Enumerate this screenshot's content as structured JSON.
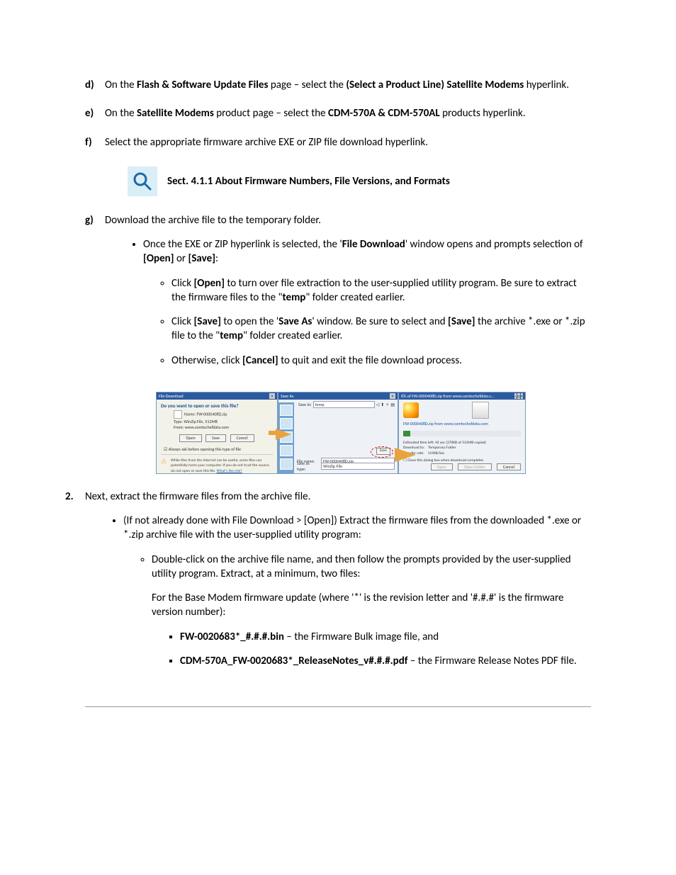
{
  "steps": {
    "d": {
      "label": "d)",
      "pre": "On the ",
      "b1": "Flash & Software Update Files",
      "mid": " page – select the ",
      "b2": "(Select a Product Line) Satellite Modems",
      "post": " hyperlink."
    },
    "e": {
      "label": "e)",
      "pre": "On the ",
      "b1": "Satellite Modems",
      "mid": " product page – select the ",
      "b2": "CDM-570A & CDM-570AL",
      "post": " products hyperlink."
    },
    "f": {
      "label": "f)",
      "text": "Select the appropriate firmware archive EXE or ZIP file download hyperlink."
    },
    "sect": "Sect. 4.1.1 About Firmware Numbers, File Versions, and Formats",
    "g": {
      "label": "g)",
      "text": "Download the archive file to the temporary folder.",
      "b1_pre": "Once the EXE or ZIP hyperlink is selected, the '",
      "b1_b": "File Download",
      "b1_mid": "' window opens and prompts selection of ",
      "b1_b2": "[Open]",
      "b1_or": " or ",
      "b1_b3": "[Save]",
      "b1_post": ":",
      "o1_pre": "Click ",
      "o1_b": "[Open]",
      "o1_mid": " to turn over file extraction to the user-supplied utility program. Be sure to extract the firmware files to the \"",
      "o1_b2": "temp",
      "o1_post": "\" folder created earlier.",
      "o2_pre": "Click ",
      "o2_b": "[Save]",
      "o2_mid": " to open the '",
      "o2_b2": "Save As",
      "o2_mid2": "' window. Be sure to select and ",
      "o2_b3": "[Save]",
      "o2_mid3": " the archive *.exe or *.zip file to the \"",
      "o2_b4": "temp",
      "o2_post": "\" folder created earlier.",
      "o3_pre": "Otherwise, click ",
      "o3_b": "[Cancel]",
      "o3_post": " to quit and exit the file download process."
    },
    "two": {
      "label": "2.",
      "text": "Next, extract the firmware files from the archive file.",
      "b1": "(If not already done with File Download > [Open]) Extract the firmware files from the downloaded *.exe or *.zip archive file with the user-supplied utility program:",
      "o1": "Double-click on the archive file name, and then follow the prompts provided by the user-supplied utility program. Extract, at a minimum, two files:",
      "para": "For the Base Modem firmware update (where '*' is the revision letter and '#.#.#' is the firmware version number):",
      "s1_b": "FW-0020683*_#.#.#.bin",
      "s1_post": " – the Firmware Bulk image file, and",
      "s2_b": "CDM-570A_FW-0020683*_ReleaseNotes_v#.#.#.pdf",
      "s2_post": " – the Firmware Release Notes PDF file."
    }
  },
  "dlg1": {
    "title": "File Download",
    "question": "Do you want to open or save this file?",
    "name": "Name:  FW-0000408D.zip",
    "type": "Type:  WinZip File, 512MB",
    "from": "From:  www.comtechefdata.com",
    "open": "Open",
    "save": "Save",
    "cancel": "Cancel",
    "ask": "Always ask before opening this type of file",
    "warn": "While files from the Internet can be useful, some files can potentially harm your computer. If you do not trust the source, do not open or save this file. ",
    "risk": "What's the risk?"
  },
  "dlg2": {
    "title": "Save As",
    "savein": "Save in:",
    "savein_val": "temp",
    "filename": "File name:",
    "filename_val": "FW-0000408D.zip",
    "saveas": "Save as type:",
    "saveas_val": "WinZip File",
    "save": "Save"
  },
  "dlg3": {
    "title": "6% of FW-0000408D.zip from www.comtechefdata.c…",
    "line1": "FW-0000408D.zip from www.comtechefdata.com",
    "est_lbl": "Estimated time left:",
    "est_val": "42 sec (370KB of 512MB copied)",
    "dl_lbl": "Download to:",
    "dl_val": "Temporary Folder",
    "tr_lbl": "Transfer rate:",
    "tr_val": "119KB/Sec",
    "close": "Close this dialog box when download completes",
    "openb": "Open",
    "openf": "Open Folder",
    "cancel": "Cancel"
  }
}
